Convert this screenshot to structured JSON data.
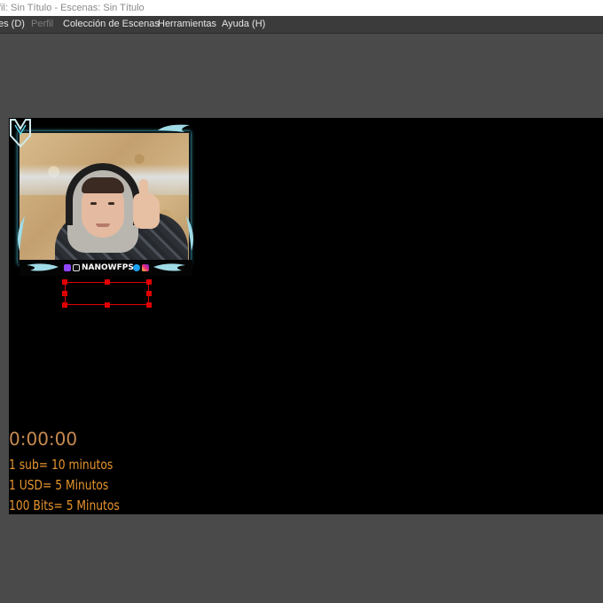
{
  "window": {
    "title_visible": "fil: Sin Título - Escenas: Sin Título"
  },
  "menubar": {
    "items": [
      {
        "label": "es (D)",
        "enabled": true
      },
      {
        "label": "Perfil",
        "enabled": false
      },
      {
        "label": "Colección de Escenas",
        "enabled": true
      },
      {
        "label": "Herramientas",
        "enabled": true
      },
      {
        "label": "Ayuda (H)",
        "enabled": true
      }
    ]
  },
  "preview": {
    "webcam": {
      "channel_name": "NANOWFPS",
      "social_icons": [
        "twitch-icon",
        "tiktok-icon",
        "twitter-icon",
        "instagram-icon"
      ],
      "logo_text": "NM"
    },
    "timer": "0:00:00",
    "rules": [
      "1 sub= 10 minutos",
      "1 USD= 5 Minutos",
      "100 Bits= 5 Minutos"
    ]
  },
  "colors": {
    "workspace_bg": "#4a4a4a",
    "menubar_bg": "#3b3b3b",
    "canvas_bg": "#000000",
    "timer_text": "#c78a50",
    "rule_text": "#e7952e",
    "selection": "#e00000",
    "accent_glow": "#4fd4e8"
  }
}
